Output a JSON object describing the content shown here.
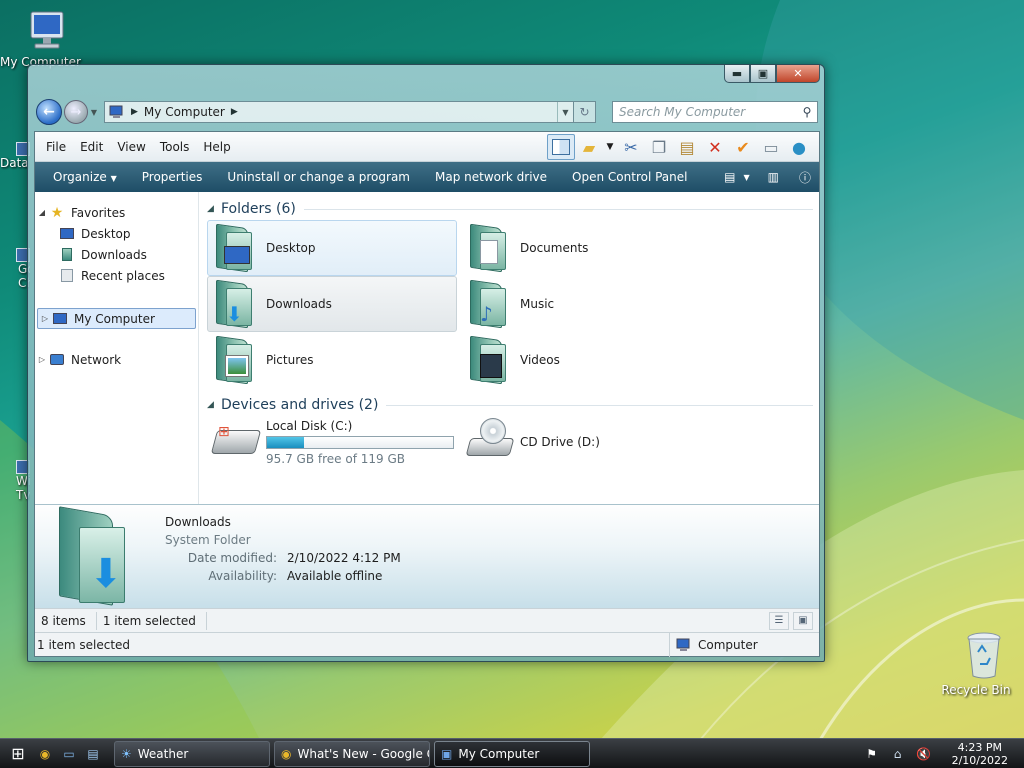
{
  "desktop": {
    "icons": [
      {
        "label": "My Computer"
      },
      {
        "label": "Recycle Bin"
      }
    ],
    "partial_labels": [
      "Data",
      "Go",
      "Ch",
      "Wi",
      "Tv"
    ]
  },
  "window": {
    "address": {
      "crumb": "My Computer"
    },
    "search": {
      "placeholder": "Search My Computer"
    },
    "menu": [
      "File",
      "Edit",
      "View",
      "Tools",
      "Help"
    ],
    "commands": [
      "Organize",
      "Properties",
      "Uninstall or change a program",
      "Map network drive",
      "Open Control Panel"
    ],
    "nav_pane": {
      "favorites": "Favorites",
      "favorites_items": [
        "Desktop",
        "Downloads",
        "Recent places"
      ],
      "computer": "My Computer",
      "network": "Network"
    },
    "folders_group": "Folders (6)",
    "folders": [
      {
        "name": "Desktop",
        "icon": "desktop-folder-icon"
      },
      {
        "name": "Documents",
        "icon": "documents-folder-icon"
      },
      {
        "name": "Downloads",
        "icon": "downloads-folder-icon"
      },
      {
        "name": "Music",
        "icon": "music-folder-icon"
      },
      {
        "name": "Pictures",
        "icon": "pictures-folder-icon"
      },
      {
        "name": "Videos",
        "icon": "videos-folder-icon"
      }
    ],
    "devices_group": "Devices and drives (2)",
    "drives": [
      {
        "name": "Local Disk (C:)",
        "free": "95.7 GB free of 119 GB",
        "used_fraction": 0.2
      },
      {
        "name": "CD Drive (D:)"
      }
    ],
    "details": {
      "title": "Downloads",
      "type": "System Folder",
      "modified_key": "Date modified:",
      "modified_val": "2/10/2022 4:12 PM",
      "avail_key": "Availability:",
      "avail_val": "Available offline"
    },
    "status": {
      "count": "8 items",
      "selected": "1 item selected",
      "bottom_selected": "1 item selected",
      "zone": "Computer"
    }
  },
  "taskbar": {
    "tasks": [
      "Weather",
      "What's New - Google Ch...",
      "My Computer"
    ],
    "time": "4:23 PM",
    "date": "2/10/2022"
  }
}
